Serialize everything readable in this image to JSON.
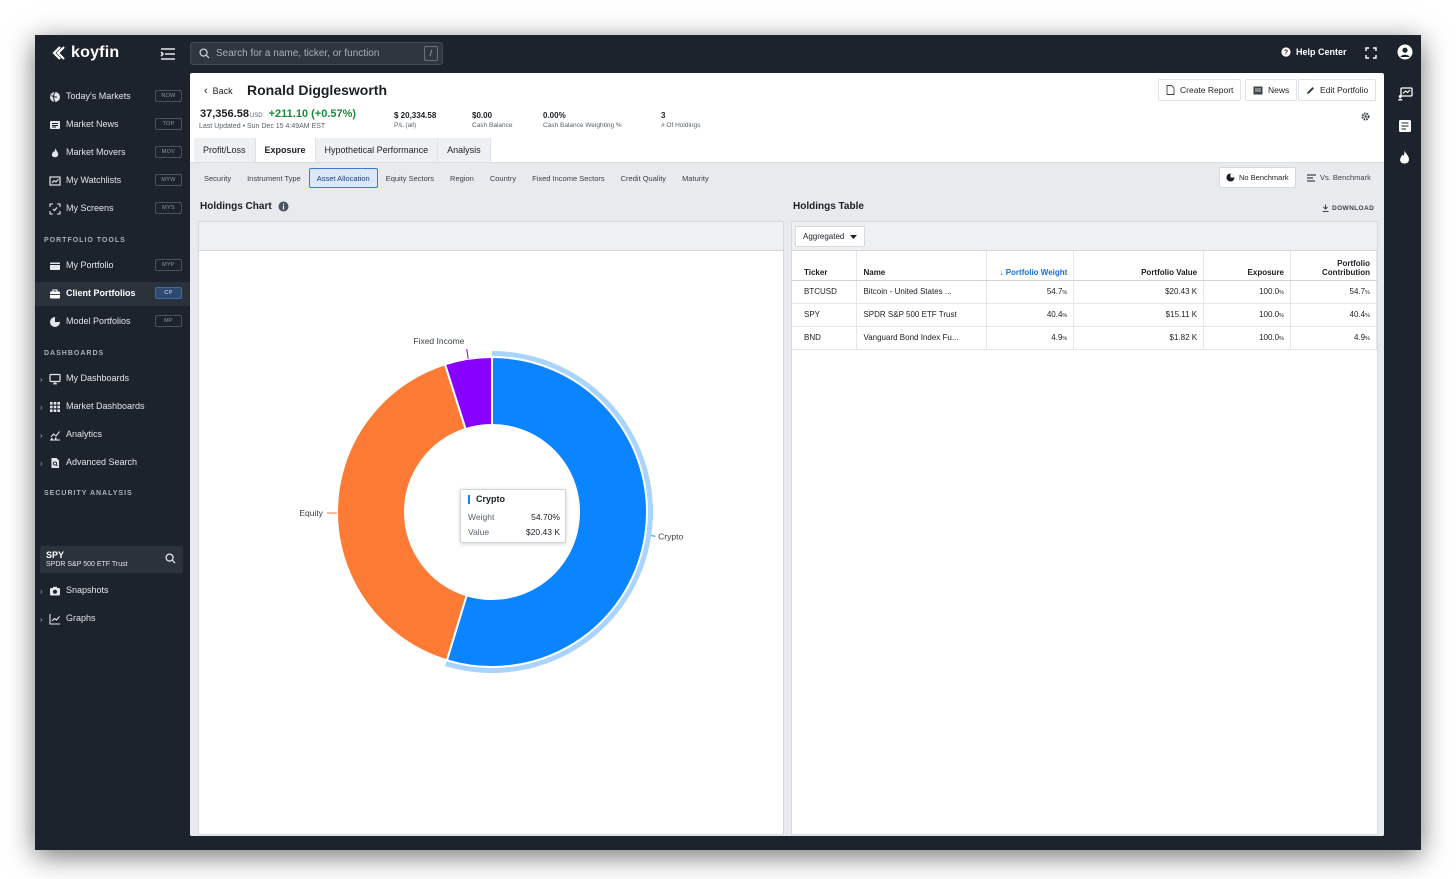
{
  "app": {
    "logo_text": "koyfin"
  },
  "topbar": {
    "search_placeholder": "Search for a name, ticker, or function",
    "search_shortcut": "/",
    "help_label": "Help Center"
  },
  "sidebar": {
    "items_top": [
      {
        "label": "Today's Markets",
        "badge": "NOW",
        "icon": "globe-icon"
      },
      {
        "label": "Market News",
        "badge": "TOP",
        "icon": "newspaper-icon"
      },
      {
        "label": "Market Movers",
        "badge": "MOV",
        "icon": "flame-icon"
      },
      {
        "label": "My Watchlists",
        "badge": "MYW",
        "icon": "watchlist-icon"
      },
      {
        "label": "My Screens",
        "badge": "MYS",
        "icon": "screen-icon"
      }
    ],
    "portfolio_heading": "PORTFOLIO TOOLS",
    "portfolio_items": [
      {
        "label": "My Portfolio",
        "badge": "MYP",
        "icon": "wallet-icon"
      },
      {
        "label": "Client Portfolios",
        "badge": "CP",
        "icon": "briefcase-icon",
        "active": true
      },
      {
        "label": "Model Portfolios",
        "badge": "MP",
        "icon": "pie-icon"
      }
    ],
    "dashboards_heading": "DASHBOARDS",
    "dashboard_items": [
      {
        "label": "My Dashboards",
        "icon": "monitor-icon"
      },
      {
        "label": "Market Dashboards",
        "icon": "grid-icon"
      },
      {
        "label": "Analytics",
        "icon": "analytics-icon"
      },
      {
        "label": "Advanced Search",
        "icon": "document-search-icon"
      }
    ],
    "security_heading": "SECURITY ANALYSIS",
    "security": {
      "ticker": "SPY",
      "name": "SPDR S&P 500 ETF Trust"
    },
    "security_items": [
      {
        "label": "Snapshots",
        "icon": "camera-icon"
      },
      {
        "label": "Graphs",
        "icon": "line-chart-icon"
      }
    ]
  },
  "header": {
    "back_label": "Back",
    "client_name": "Ronald Digglesworth",
    "create_report_label": "Create Report",
    "news_label": "News",
    "edit_portfolio_label": "Edit Portfolio",
    "total_value": "37,356.58",
    "currency": "USD",
    "change": "+211.10 (+0.57%)",
    "last_updated": "Last Updated • Sun Dec 15 4:49AM EST",
    "stats": [
      {
        "value": "$ 20,334.58",
        "label": "P/L (all)"
      },
      {
        "value": "$0.00",
        "label": "Cash Balance"
      },
      {
        "value": "0.00%",
        "label": "Cash Balance Weighting %"
      },
      {
        "value": "3",
        "label": "# Of Holdings"
      }
    ]
  },
  "tabs": [
    "Profit/Loss",
    "Exposure",
    "Hypothetical Performance",
    "Analysis"
  ],
  "active_tab": "Exposure",
  "subtabs": [
    "Security",
    "Instrument Type",
    "Asset Allocation",
    "Equity Sectors",
    "Region",
    "Country",
    "Fixed Income Sectors",
    "Credit Quality",
    "Maturity"
  ],
  "active_subtab": "Asset Allocation",
  "benchmark": {
    "no_benchmark_label": "No Benchmark",
    "vs_benchmark_label": "Vs. Benchmark"
  },
  "holdings_chart": {
    "title": "Holdings Chart",
    "tooltip": {
      "name": "Crypto",
      "weight_label": "Weight",
      "weight_value": "54.70%",
      "value_label": "Value",
      "value_value": "$20.43 K"
    }
  },
  "chart_data": {
    "type": "pie",
    "style": "donut",
    "categories": [
      "Crypto",
      "Equity",
      "Fixed Income"
    ],
    "values": [
      54.7,
      40.4,
      4.9
    ],
    "colors": [
      "#0a84ff",
      "#fe7b36",
      "#8800ff"
    ],
    "highlighted": "Crypto"
  },
  "holdings_table": {
    "title": "Holdings Table",
    "download_label": "DOWNLOAD",
    "aggregation": "Aggregated",
    "columns": [
      "Ticker",
      "Name",
      "Portfolio Weight",
      "Portfolio Value",
      "Exposure",
      "Portfolio Contribution"
    ],
    "rows": [
      {
        "ticker": "BTCUSD",
        "name": "Bitcoin - United States ...",
        "weight": "54.7",
        "value": "$20.43 K",
        "exposure": "100.0",
        "contribution": "54.7"
      },
      {
        "ticker": "SPY",
        "name": "SPDR S&P 500 ETF Trust",
        "weight": "40.4",
        "value": "$15.11 K",
        "exposure": "100.0",
        "contribution": "40.4"
      },
      {
        "ticker": "BND",
        "name": "Vanguard Bond Index Fu...",
        "weight": "4.9",
        "value": "$1.82 K",
        "exposure": "100.0",
        "contribution": "4.9"
      }
    ],
    "percent_suffix": "%"
  }
}
